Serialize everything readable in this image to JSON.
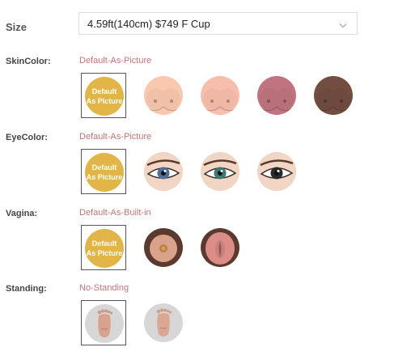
{
  "size": {
    "label": "Size",
    "selected": "4.59ft(140cm) $749 F Cup"
  },
  "options": [
    {
      "key": "skin",
      "label": "SkinColor:",
      "value": "Default-As-Picture",
      "default_text": [
        "Default",
        "As Picture"
      ],
      "swatch_colors": [
        "#f0c0a8",
        "#eeb7a6",
        "#b8707a",
        "#6e4a3e"
      ]
    },
    {
      "key": "eye",
      "label": "EyeColor:",
      "value": "Default-As-Picture",
      "default_text": [
        "Default",
        "As Picture"
      ],
      "swatch_colors": [
        "#4f6f9a",
        "#3c7a74",
        "#2a2a2a"
      ]
    },
    {
      "key": "vagina",
      "label": "Vagina:",
      "value": "Default-As-Built-in",
      "default_text": [
        "Default",
        "As Picture"
      ],
      "swatch_colors": [
        "#d9a38a",
        "#c9807c"
      ]
    },
    {
      "key": "standing",
      "label": "Standing:",
      "value": "No-Standing",
      "swatch_colors": [
        "#d9a28e",
        "#dba793"
      ]
    }
  ],
  "colors": {
    "value_text": "#c0757a",
    "default_badge": "#e1b547",
    "feet_bg": "#d7d7d7"
  }
}
